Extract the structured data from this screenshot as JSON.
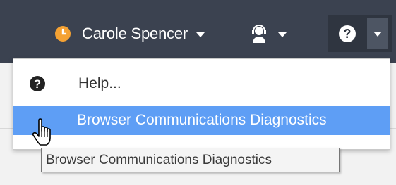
{
  "header": {
    "user": {
      "name": "Carole Spencer",
      "presence_color": "#f5a233",
      "presence_icon": "clock-icon",
      "caret_icon": "caret-down-icon"
    },
    "agent_menu": {
      "icon": "agent-headset-icon",
      "caret_icon": "caret-down-icon"
    },
    "help": {
      "icon": "question-circle-icon",
      "caret_icon": "caret-down-icon"
    },
    "background_color": "#3b4250"
  },
  "help_menu": {
    "items": [
      {
        "label": "Help...",
        "icon": "question-circle-icon",
        "highlighted": false
      },
      {
        "label": "Browser Communications Diagnostics",
        "icon": "",
        "highlighted": true
      }
    ],
    "highlight_color": "#5e9ef5"
  },
  "cursor": {
    "icon": "hand-pointer-icon"
  },
  "tooltip": {
    "text": "Browser Communications Diagnostics"
  }
}
